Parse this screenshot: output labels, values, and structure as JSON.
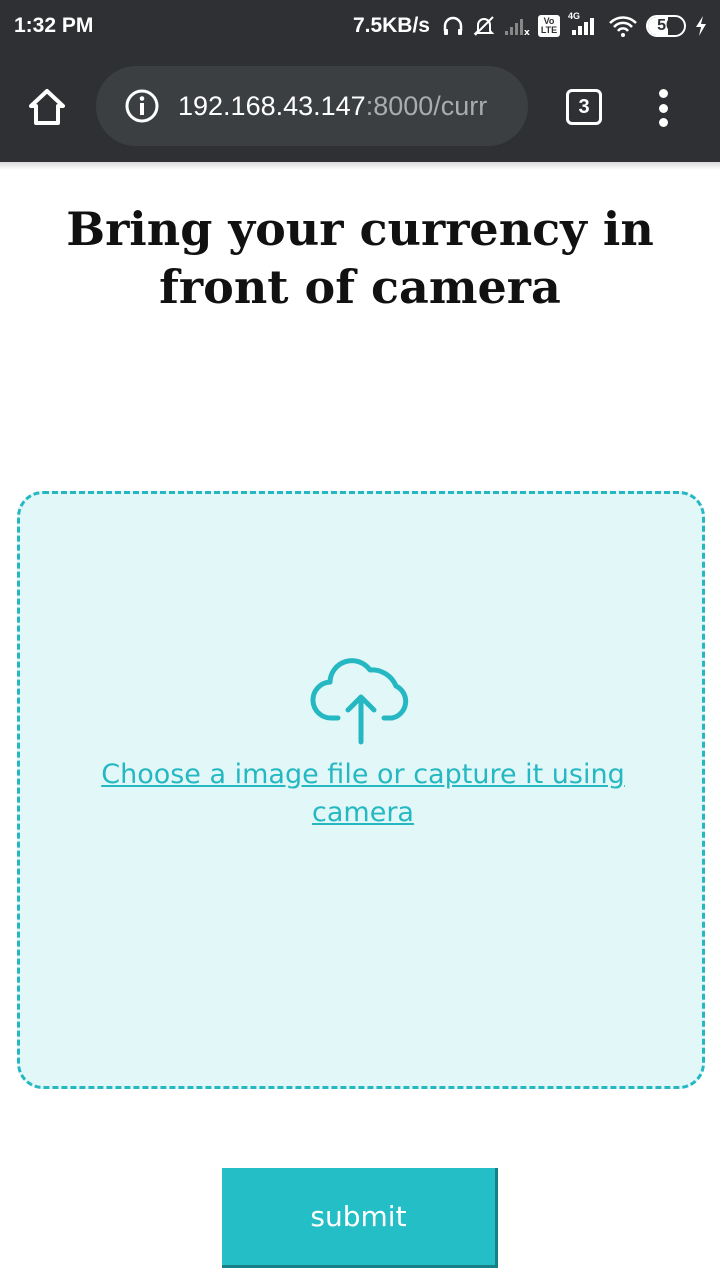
{
  "status_bar": {
    "time": "1:32 PM",
    "net_speed": "7.5KB/s",
    "volte_label": "Vo\nLTE",
    "network_type": "4G",
    "battery_level": "56",
    "battery_fraction": 0.56,
    "icons": [
      "headphones-icon",
      "mute-bell-icon",
      "signal-icon",
      "volte-icon",
      "signal-4g-icon",
      "wifi-icon",
      "battery-icon",
      "charging-icon"
    ]
  },
  "browser": {
    "url_host": "192.168.43.147",
    "url_path": ":8000/curr",
    "tab_count": "3",
    "icons": [
      "home-icon",
      "info-icon",
      "more-vert-icon"
    ]
  },
  "page": {
    "title": "Bring your currency in front of camera",
    "upload_link": "Choose a image file or capture it using camera",
    "submit_label": "submit"
  },
  "colors": {
    "accent": "#26b8c2",
    "dropzone_bg": "#e2f8f8",
    "toolbar_bg": "#2e3033"
  }
}
